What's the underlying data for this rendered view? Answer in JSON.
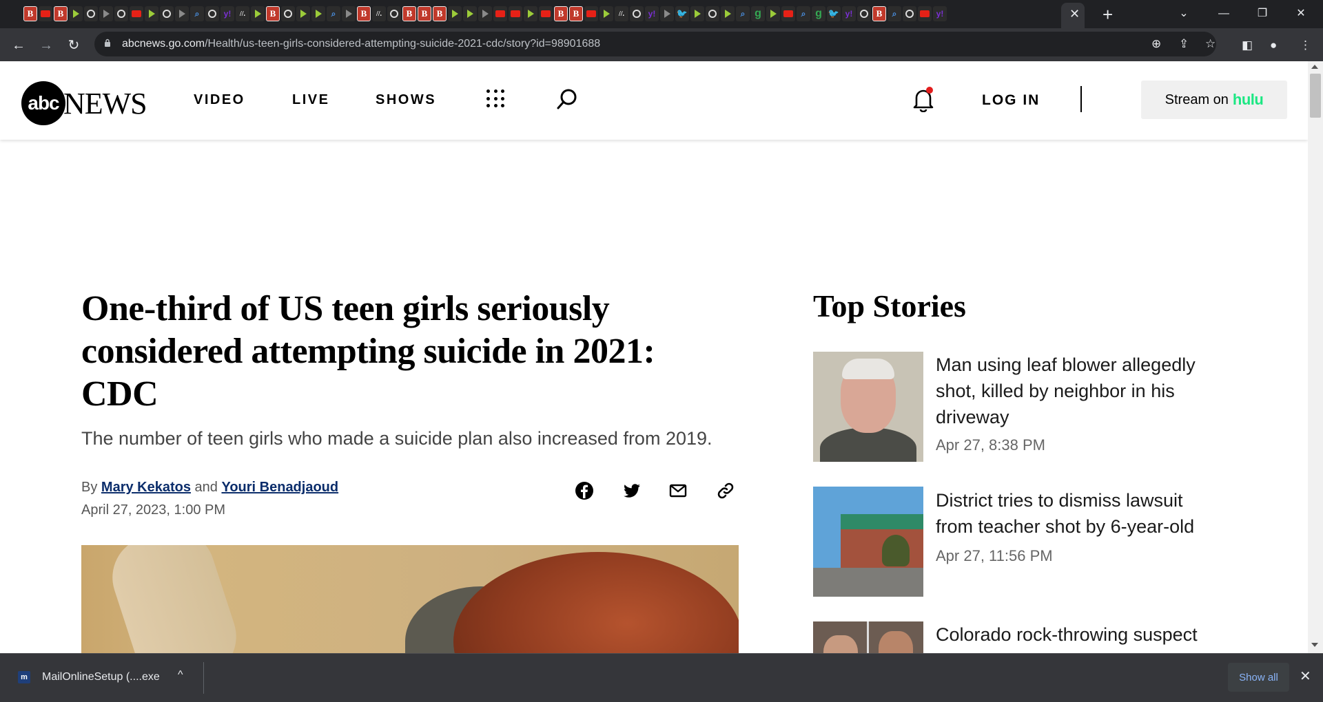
{
  "browser": {
    "url_host": "abcnews.go.com",
    "url_path": "/Health/us-teen-girls-considered-attempting-suicide-2021-cdc/story?id=98901688",
    "tab_close": "✕",
    "new_tab": "+",
    "win_dropdown": "⌄",
    "win_minimize": "—",
    "win_restore": "❐",
    "win_close": "✕"
  },
  "header": {
    "logo_abc": "abc",
    "logo_news": "NEWS",
    "nav": [
      "VIDEO",
      "LIVE",
      "SHOWS"
    ],
    "login": "LOG IN",
    "stream_prefix": "Stream on",
    "stream_brand": "hulu",
    "notification_dot_color": "#e21d1d"
  },
  "article": {
    "headline": "One-third of US teen girls seriously considered attempting suicide in 2021: CDC",
    "subhead": "The number of teen girls who made a suicide plan also increased from 2019.",
    "by": "By",
    "author1": "Mary Kekatos",
    "and": "and",
    "author2": "Youri Benadjaoud",
    "date": "April 27, 2023, 1:00 PM"
  },
  "top_stories": {
    "title": "Top Stories",
    "items": [
      {
        "title": "Man using leaf blower allegedly shot, killed by neighbor in his driveway",
        "time": "Apr 27, 8:38 PM"
      },
      {
        "title": "District tries to dismiss lawsuit from teacher shot by 6-year-old",
        "time": "Apr 27, 11:56 PM"
      },
      {
        "title": "Colorado rock-throwing suspect",
        "time": ""
      }
    ]
  },
  "download_bar": {
    "icon_letter": "m",
    "filename": "MailOnlineSetup (....exe",
    "chevron": "^",
    "show_all": "Show all",
    "close": "✕"
  }
}
